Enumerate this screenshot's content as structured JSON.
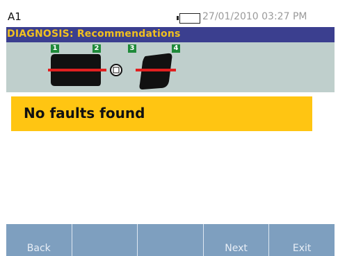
{
  "status_bar": {
    "left_label": "A1",
    "datetime": "27/01/2010 03:27 PM"
  },
  "title_bar": {
    "title": "DIAGNOSIS: Recommendations"
  },
  "machine_train": {
    "measurement_points": [
      "1",
      "2",
      "3",
      "4"
    ],
    "colors": {
      "panel_background": "#bfcfcc",
      "component": "#111111",
      "shaft": "#e02020",
      "point_badge": "#1f8a3a"
    }
  },
  "message": {
    "text": "No faults found",
    "background": "#ffc512"
  },
  "softkeys": [
    {
      "label": "Back"
    },
    {
      "label": ""
    },
    {
      "label": ""
    },
    {
      "label": "Next"
    },
    {
      "label": "Exit"
    }
  ],
  "colors": {
    "title_background": "#3b3f8f",
    "title_text": "#f0c020",
    "softkey_background": "#7e9fbf"
  }
}
